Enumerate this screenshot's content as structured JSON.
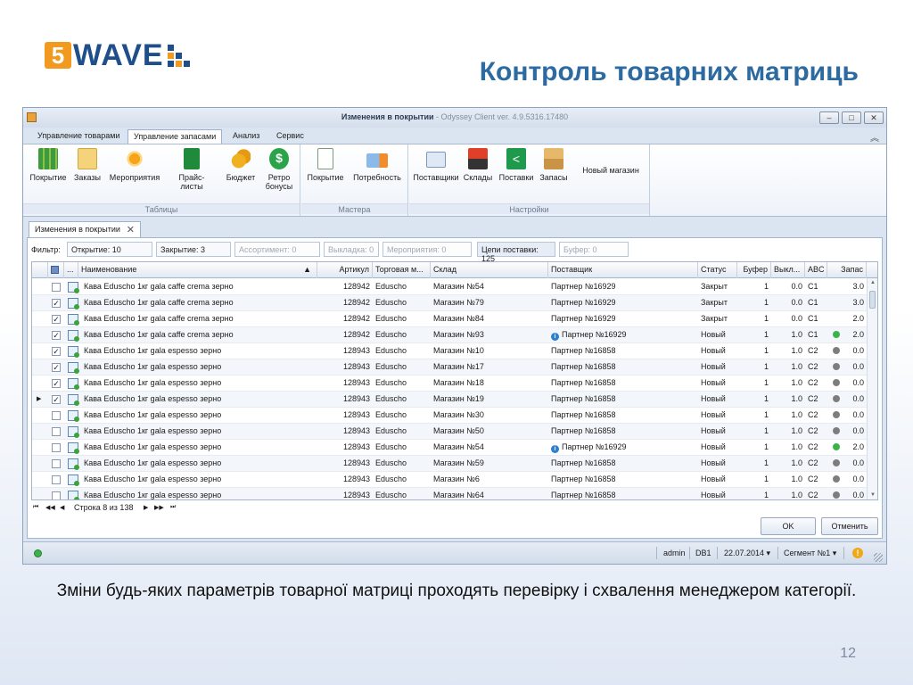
{
  "slide": {
    "logo_digit": "5",
    "logo_word": "WAVE",
    "title": "Контроль товарних матриць",
    "caption": "Зміни будь-яких параметрів товарної матриці проходять перевірку і схвалення менеджером категорії.",
    "page_number": "12"
  },
  "window": {
    "title_main": "Изменения в покрытии",
    "title_sub": " - Odyssey Client ver. 4.9.5316.17480",
    "controls": {
      "minimize": "–",
      "maximize": "□",
      "close": "✕"
    }
  },
  "menu_tabs": [
    "Управление товарами",
    "Управление запасами",
    "Анализ",
    "Сервис"
  ],
  "active_menu_tab": "Управление запасами",
  "ribbon": {
    "groups": [
      {
        "label": "Таблицы",
        "buttons": [
          "Покрытие",
          "Заказы",
          "Мероприятия",
          "Прайс-листы",
          "Бюджет",
          "Ретро бонусы"
        ]
      },
      {
        "label": "Мастера",
        "buttons": [
          "Покрытие",
          "Потребность"
        ]
      },
      {
        "label": "Настройки",
        "buttons": [
          "Поставщики",
          "Склады",
          "Поставки",
          "Запасы",
          "Новый магазин"
        ]
      }
    ]
  },
  "doc_tab": {
    "label": "Изменения в покрытии",
    "close": "✕"
  },
  "filter": {
    "label": "Фильтр:",
    "chips": [
      {
        "text": "Открытие: 10",
        "state": "active"
      },
      {
        "text": "Закрытие: 3",
        "state": "active"
      },
      {
        "text": "Ассортимент: 0",
        "state": "dim"
      },
      {
        "text": "Выкладка: 0",
        "state": "dim"
      },
      {
        "text": "Мероприятия: 0",
        "state": "dim"
      },
      {
        "text": "Цепи поставки: 125",
        "state": "highlight"
      },
      {
        "text": "Буфер: 0",
        "state": "dim"
      }
    ]
  },
  "grid": {
    "columns": [
      "...",
      "Наименование",
      "Артикул",
      "Торговая м...",
      "Склад",
      "Поставщик",
      "Статус",
      "Буфер",
      "Выкл...",
      "ABC",
      "Запас"
    ],
    "sort_indicator": "▲",
    "rows": [
      {
        "checked": false,
        "name": "Кава Eduscho 1кг gala caffe crema зерно",
        "article": "128942",
        "brand": "Eduscho",
        "store": "Магазин №54",
        "supplier": "Партнер №16929",
        "info": false,
        "status": "Закрыт",
        "buffer": "1",
        "display": "0.0",
        "abc": "C1",
        "dot": "",
        "stock": "3.0"
      },
      {
        "checked": true,
        "name": "Кава Eduscho 1кг gala caffe crema зерно",
        "article": "128942",
        "brand": "Eduscho",
        "store": "Магазин №79",
        "supplier": "Партнер №16929",
        "info": false,
        "status": "Закрыт",
        "buffer": "1",
        "display": "0.0",
        "abc": "C1",
        "dot": "",
        "stock": "3.0"
      },
      {
        "checked": true,
        "name": "Кава Eduscho 1кг gala caffe crema зерно",
        "article": "128942",
        "brand": "Eduscho",
        "store": "Магазин №84",
        "supplier": "Партнер №16929",
        "info": false,
        "status": "Закрыт",
        "buffer": "1",
        "display": "0.0",
        "abc": "C1",
        "dot": "",
        "stock": "2.0"
      },
      {
        "checked": true,
        "name": "Кава Eduscho 1кг gala caffe crema зерно",
        "article": "128942",
        "brand": "Eduscho",
        "store": "Магазин №93",
        "supplier": "Партнер №16929",
        "info": true,
        "status": "Новый",
        "buffer": "1",
        "display": "1.0",
        "abc": "C1",
        "dot": "#3bb34a",
        "stock": "2.0"
      },
      {
        "checked": true,
        "name": "Кава Eduscho 1кг gala espesso зерно",
        "article": "128943",
        "brand": "Eduscho",
        "store": "Магазин №10",
        "supplier": "Партнер №16858",
        "info": false,
        "status": "Новый",
        "buffer": "1",
        "display": "1.0",
        "abc": "C2",
        "dot": "#7d7d7d",
        "stock": "0.0"
      },
      {
        "checked": true,
        "name": "Кава Eduscho 1кг gala espesso зерно",
        "article": "128943",
        "brand": "Eduscho",
        "store": "Магазин №17",
        "supplier": "Партнер №16858",
        "info": false,
        "status": "Новый",
        "buffer": "1",
        "display": "1.0",
        "abc": "C2",
        "dot": "#7d7d7d",
        "stock": "0.0"
      },
      {
        "checked": true,
        "name": "Кава Eduscho 1кг gala espesso зерно",
        "article": "128943",
        "brand": "Eduscho",
        "store": "Магазин №18",
        "supplier": "Партнер №16858",
        "info": false,
        "status": "Новый",
        "buffer": "1",
        "display": "1.0",
        "abc": "C2",
        "dot": "#7d7d7d",
        "stock": "0.0"
      },
      {
        "checked": true,
        "name": "Кава Eduscho 1кг gala espesso зерно",
        "article": "128943",
        "brand": "Eduscho",
        "store": "Магазин №19",
        "supplier": "Партнер №16858",
        "info": false,
        "status": "Новый",
        "buffer": "1",
        "display": "1.0",
        "abc": "C2",
        "dot": "#7d7d7d",
        "stock": "0.0",
        "current": true
      },
      {
        "checked": false,
        "name": "Кава Eduscho 1кг gala espesso зерно",
        "article": "128943",
        "brand": "Eduscho",
        "store": "Магазин №30",
        "supplier": "Партнер №16858",
        "info": false,
        "status": "Новый",
        "buffer": "1",
        "display": "1.0",
        "abc": "C2",
        "dot": "#7d7d7d",
        "stock": "0.0"
      },
      {
        "checked": false,
        "name": "Кава Eduscho 1кг gala espesso зерно",
        "article": "128943",
        "brand": "Eduscho",
        "store": "Магазин №50",
        "supplier": "Партнер №16858",
        "info": false,
        "status": "Новый",
        "buffer": "1",
        "display": "1.0",
        "abc": "C2",
        "dot": "#7d7d7d",
        "stock": "0.0"
      },
      {
        "checked": false,
        "name": "Кава Eduscho 1кг gala espesso зерно",
        "article": "128943",
        "brand": "Eduscho",
        "store": "Магазин №54",
        "supplier": "Партнер №16929",
        "info": true,
        "status": "Новый",
        "buffer": "1",
        "display": "1.0",
        "abc": "C2",
        "dot": "#3bb34a",
        "stock": "2.0"
      },
      {
        "checked": false,
        "name": "Кава Eduscho 1кг gala espesso зерно",
        "article": "128943",
        "brand": "Eduscho",
        "store": "Магазин №59",
        "supplier": "Партнер №16858",
        "info": false,
        "status": "Новый",
        "buffer": "1",
        "display": "1.0",
        "abc": "C2",
        "dot": "#7d7d7d",
        "stock": "0.0"
      },
      {
        "checked": false,
        "name": "Кава Eduscho 1кг gala espesso зерно",
        "article": "128943",
        "brand": "Eduscho",
        "store": "Магазин №6",
        "supplier": "Партнер №16858",
        "info": false,
        "status": "Новый",
        "buffer": "1",
        "display": "1.0",
        "abc": "C2",
        "dot": "#7d7d7d",
        "stock": "0.0"
      },
      {
        "checked": false,
        "name": "Кава Eduscho 1кг gala espesso зерно",
        "article": "128943",
        "brand": "Eduscho",
        "store": "Магазин №64",
        "supplier": "Партнер №16858",
        "info": false,
        "status": "Новый",
        "buffer": "1",
        "display": "1.0",
        "abc": "C2",
        "dot": "#7d7d7d",
        "stock": "0.0"
      }
    ]
  },
  "pager": {
    "first": "⏮",
    "prev_page": "◀◀",
    "prev": "◀",
    "text": "Строка 8 из 138",
    "next": "▶",
    "next_page": "▶▶",
    "last": "⏭"
  },
  "buttons": {
    "ok": "OK",
    "cancel": "Отменить"
  },
  "statusbar": {
    "user": "admin",
    "db": "DB1",
    "date": "22.07.2014 ▾",
    "segment": "Сегмент №1 ▾",
    "warning": "!"
  }
}
